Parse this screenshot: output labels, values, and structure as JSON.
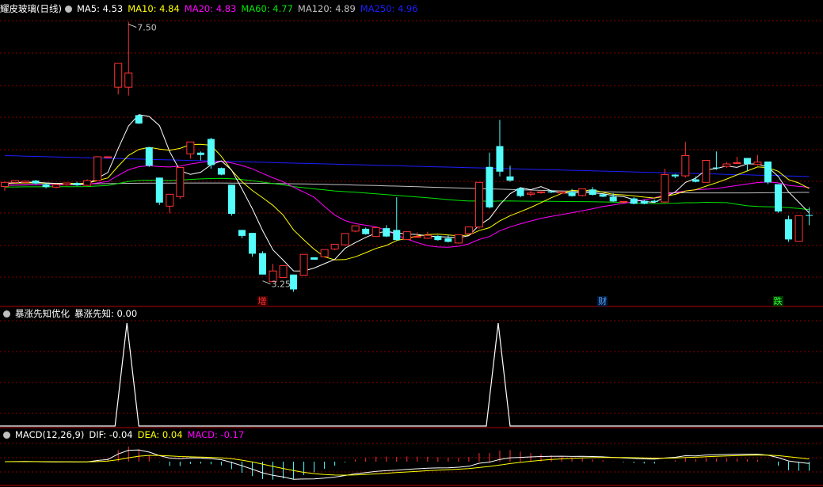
{
  "colors": {
    "background": "#000000",
    "grid": "#8b0000",
    "up": "#ff3232",
    "down": "#54fcfc",
    "ma5": "#ffffff",
    "ma10": "#ffff00",
    "ma20": "#ff00ff",
    "ma60": "#00e600",
    "ma120": "#c0c0c0",
    "ma250": "#1e1eff",
    "dif": "#ffffff",
    "dea": "#ffff00",
    "macd": "#ff00ff"
  },
  "header": {
    "stock_name": "耀皮玻璃(日线)",
    "ma": [
      {
        "label": "MA5: 4.53",
        "color": "#ffffff"
      },
      {
        "label": "MA10: 4.84",
        "color": "#ffff00"
      },
      {
        "label": "MA20: 4.83",
        "color": "#ff00ff"
      },
      {
        "label": "MA60: 4.77",
        "color": "#00e600"
      },
      {
        "label": "MA120: 4.89",
        "color": "#c0c0c0"
      },
      {
        "label": "MA250: 4.96",
        "color": "#1e1eff"
      }
    ]
  },
  "indicator1": {
    "name": "暴涨先知优化",
    "value_label": "暴涨先知: 0.00"
  },
  "indicator2": {
    "name": "MACD(12,26,9)",
    "dif_label": "DIF: -0.04",
    "dea_label": "DEA: 0.04",
    "macd_label": "MACD: -0.17"
  },
  "annotations": {
    "high_label": "7.50",
    "low_label": "3.25"
  },
  "event_tags": [
    {
      "text": "增",
      "color": "#ff3232",
      "bg": "#3a0000"
    },
    {
      "text": "财",
      "color": "#54a0ff",
      "bg": "#001a3a"
    },
    {
      "text": "跌",
      "color": "#33ff33",
      "bg": "#003a00"
    }
  ],
  "chart_data": [
    {
      "type": "candlestick",
      "ohlc": [
        [
          4.73,
          4.8,
          4.66,
          4.81
        ],
        [
          4.8,
          4.83,
          4.79,
          4.84
        ],
        [
          4.8,
          4.82,
          4.79,
          4.83
        ],
        [
          4.83,
          4.78,
          4.77,
          4.84
        ],
        [
          4.77,
          4.72,
          4.7,
          4.79
        ],
        [
          4.72,
          4.76,
          4.7,
          4.78
        ],
        [
          4.76,
          4.79,
          4.74,
          4.8
        ],
        [
          4.79,
          4.75,
          4.74,
          4.81
        ],
        [
          4.75,
          4.83,
          4.74,
          4.85
        ],
        [
          4.83,
          5.23,
          4.83,
          5.24
        ],
        [
          5.23,
          5.23,
          5.23,
          5.23
        ],
        [
          6.4,
          6.8,
          6.28,
          6.8
        ],
        [
          6.4,
          6.64,
          6.26,
          7.5
        ],
        [
          5.93,
          5.79,
          5.78,
          5.93
        ],
        [
          5.39,
          5.08,
          5.06,
          5.39
        ],
        [
          4.88,
          4.46,
          4.42,
          4.88
        ],
        [
          4.4,
          4.6,
          4.28,
          4.6
        ],
        [
          4.56,
          5.05,
          4.52,
          5.05
        ],
        [
          5.28,
          5.48,
          5.2,
          5.48
        ],
        [
          5.3,
          5.26,
          5.17,
          5.32
        ],
        [
          5.53,
          5.09,
          5.03,
          5.55
        ],
        [
          5.04,
          4.93,
          4.92,
          5.05
        ],
        [
          4.76,
          4.27,
          4.24,
          4.76
        ],
        [
          4.0,
          3.9,
          3.86,
          4.0
        ],
        [
          3.95,
          3.6,
          3.55,
          3.95
        ],
        [
          3.61,
          3.25,
          3.25,
          3.64
        ],
        [
          3.13,
          3.31,
          3.31,
          3.43
        ],
        [
          3.2,
          3.4,
          3.2,
          3.4
        ],
        [
          3.25,
          3.0,
          2.96,
          3.25
        ],
        [
          3.24,
          3.59,
          3.24,
          3.59
        ],
        [
          3.54,
          3.5,
          3.5,
          3.54
        ],
        [
          3.55,
          3.67,
          3.55,
          3.67
        ],
        [
          3.68,
          3.76,
          3.66,
          3.76
        ],
        [
          3.75,
          3.94,
          3.74,
          3.94
        ],
        [
          3.98,
          4.07,
          3.96,
          4.07
        ],
        [
          4.02,
          3.93,
          3.92,
          4.04
        ],
        [
          3.89,
          4.04,
          3.88,
          4.04
        ],
        [
          4.03,
          3.89,
          3.88,
          4.08
        ],
        [
          4.0,
          3.83,
          3.82,
          4.55
        ],
        [
          3.84,
          3.97,
          3.84,
          3.97
        ],
        [
          3.89,
          3.89,
          3.89,
          3.96
        ],
        [
          3.86,
          3.91,
          3.85,
          3.97
        ],
        [
          3.9,
          3.83,
          3.82,
          3.91
        ],
        [
          3.86,
          3.8,
          3.79,
          3.92
        ],
        [
          3.78,
          3.92,
          3.77,
          3.92
        ],
        [
          3.94,
          4.05,
          3.93,
          4.05
        ],
        [
          4.05,
          4.8,
          4.02,
          4.8
        ],
        [
          5.06,
          4.38,
          4.36,
          5.3
        ],
        [
          5.41,
          4.98,
          4.9,
          5.85
        ],
        [
          4.9,
          4.83,
          4.81,
          5.08
        ],
        [
          4.7,
          4.57,
          4.55,
          4.71
        ],
        [
          4.6,
          4.62,
          4.56,
          4.67
        ],
        [
          4.63,
          4.64,
          4.61,
          4.65
        ],
        [
          4.65,
          4.63,
          4.62,
          4.67
        ],
        [
          4.62,
          4.64,
          4.61,
          4.65
        ],
        [
          4.64,
          4.57,
          4.56,
          4.69
        ],
        [
          4.58,
          4.69,
          4.56,
          4.69
        ],
        [
          4.68,
          4.59,
          4.58,
          4.72
        ],
        [
          4.6,
          4.56,
          4.55,
          4.61
        ],
        [
          4.56,
          4.48,
          4.47,
          4.62
        ],
        [
          4.47,
          4.48,
          4.44,
          4.48
        ],
        [
          4.53,
          4.44,
          4.43,
          4.55
        ],
        [
          4.49,
          4.44,
          4.43,
          4.51
        ],
        [
          4.49,
          4.47,
          4.46,
          4.51
        ],
        [
          4.47,
          4.93,
          4.46,
          5.03
        ],
        [
          4.93,
          4.9,
          4.87,
          4.94
        ],
        [
          4.91,
          5.25,
          4.88,
          5.48
        ],
        [
          4.85,
          4.81,
          4.8,
          4.9
        ],
        [
          4.8,
          5.17,
          4.8,
          5.17
        ],
        [
          5.05,
          5.04,
          5.01,
          5.32
        ],
        [
          5.07,
          5.11,
          5.04,
          5.14
        ],
        [
          5.13,
          5.13,
          5.11,
          5.23
        ],
        [
          5.21,
          5.11,
          4.99,
          5.21
        ],
        [
          5.1,
          5.14,
          5.08,
          5.26
        ],
        [
          5.15,
          4.8,
          4.77,
          5.15
        ],
        [
          4.77,
          4.31,
          4.29,
          4.77
        ],
        [
          4.18,
          3.84,
          3.8,
          4.24
        ],
        [
          3.81,
          4.24,
          3.81,
          4.24
        ],
        [
          4.25,
          4.24,
          4.08,
          4.38
        ]
      ],
      "high": 7.5,
      "low": 3.25,
      "event_tag_indices": [
        25,
        58,
        75
      ]
    },
    {
      "type": "line",
      "name": "暴涨先知",
      "peak_indices": [
        12,
        48
      ],
      "peak_value": 1,
      "base_value": 0
    },
    {
      "type": "bar",
      "name": "MACD",
      "dif": -0.04,
      "dea": 0.04,
      "macd": -0.17
    }
  ]
}
